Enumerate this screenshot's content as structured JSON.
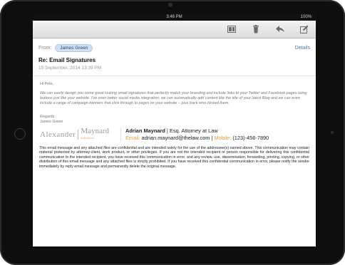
{
  "status_bar": {
    "time": "3:46 PM",
    "battery": "100%"
  },
  "toolbar": {
    "icons": [
      "folder-move-icon",
      "trash-icon",
      "reply-icon",
      "compose-icon"
    ]
  },
  "header": {
    "from_label": "From:",
    "from_name": "James Green",
    "details_link": "Details",
    "subject": "Re: Email Signatures",
    "date": "15 September, 2014 13:39 PM"
  },
  "body": {
    "greeting": "Hi Pete,",
    "paragraph": "We can easily design you some great looking email signatures that perfectly match your branding and include links to your Twitter and Facebook pages using buttons just like your website. I've even better social media integration; we can automatically add content like the title of your latest Blog and we can even include a range of campaign banners that click through to pages on your website – plus track who clicked them.",
    "regards": "Regards",
    "regards_name": "James Green"
  },
  "signature": {
    "logo_left": "Alexander",
    "logo_right": "Maynard",
    "logo_sub": "solicitors",
    "name": "Adrian Maynard",
    "title": " | Esq. Attorney at Law",
    "email_label": "Email:",
    "email": " adrian.maynard@thelaw.com | ",
    "mobile_label": "Mobile:",
    "mobile": " (123)-456-7890"
  },
  "disclaimer": "This email message and any attached files are confidential and are intended solely for the use of the addressee(s) named above. This communication may contain material protected by attorney-client, work product, or other privileges. If you are not the intended recipient or person responsible for delivering this confidential communication to the intended recipient, you have received this communication in error, and any review, use, dissemination, forwarding, printing, copying, or other distribution of this email message and any attached files is strictly prohibited. If you have received this confidential communication in error, please notify the sender immediately by reply email message and permanently delete the original message.",
  "colors": {
    "accent": "#4a78c2",
    "signature_orange": "#e89a3c",
    "chip_bg": "#cfe0f6"
  }
}
